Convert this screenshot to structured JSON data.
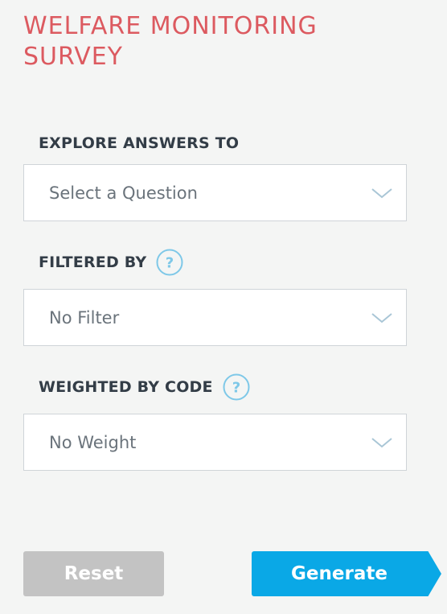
{
  "app": {
    "title": "WELFARE MONITORING SURVEY"
  },
  "colors": {
    "title": "#dc5a60",
    "label": "#333d47",
    "help_icon": "#7ec8e8",
    "generate_button": "#0aa8e6",
    "reset_button": "#c3c3c3"
  },
  "form": {
    "explore": {
      "label": "EXPLORE ANSWERS TO",
      "value": "Select a Question",
      "icon": "chevron-down-icon"
    },
    "filter": {
      "label": "FILTERED BY",
      "value": "No Filter",
      "help_icon": "question-mark",
      "icon": "chevron-down-icon"
    },
    "weight": {
      "label": "WEIGHTED BY CODE",
      "value": "No Weight",
      "help_icon": "question-mark",
      "icon": "chevron-down-icon"
    }
  },
  "actions": {
    "reset_label": "Reset",
    "generate_label": "Generate"
  }
}
